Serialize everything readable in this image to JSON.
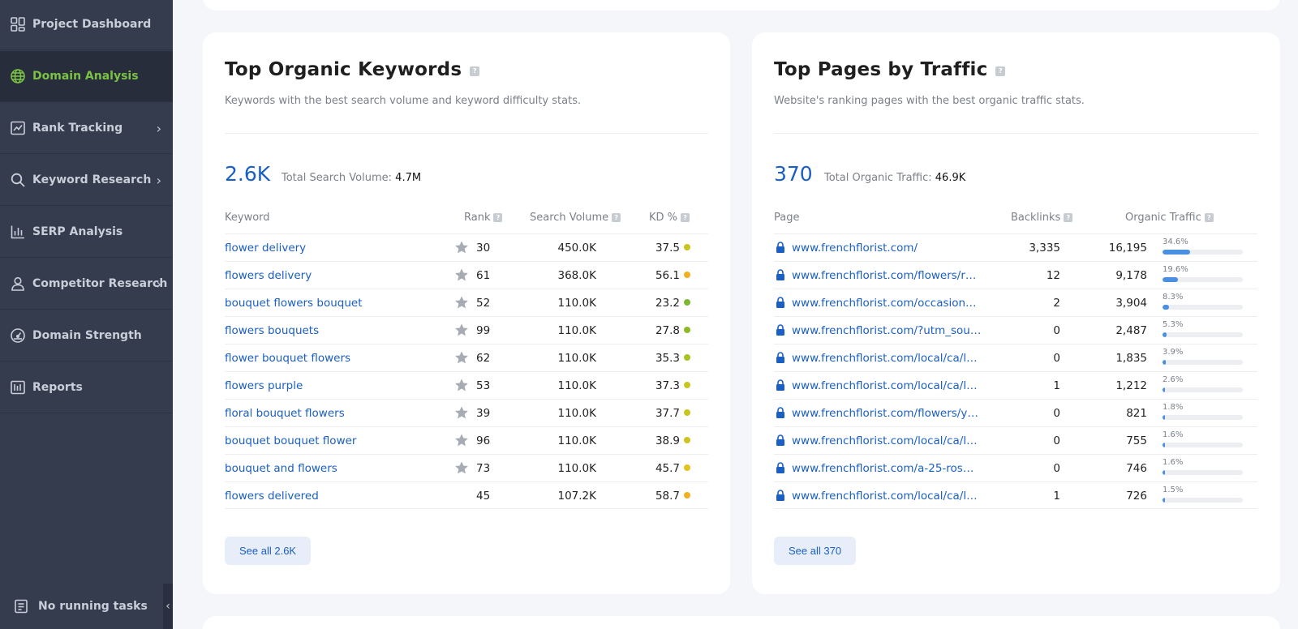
{
  "sidebar": {
    "items": [
      {
        "label": "Project Dashboard",
        "icon": "grid-icon",
        "top": 0,
        "active": false,
        "chevron": false
      },
      {
        "label": "Domain Analysis",
        "icon": "globe-icon",
        "active": true,
        "chevron": false
      },
      {
        "label": "Rank Tracking",
        "icon": "chart-line-icon",
        "active": false,
        "chevron": true
      },
      {
        "label": "Keyword Research",
        "icon": "search-icon",
        "active": false,
        "chevron": true
      },
      {
        "label": "SERP Analysis",
        "icon": "bar-chart-icon",
        "active": false,
        "chevron": false
      },
      {
        "label": "Competitor Research",
        "icon": "user-icon",
        "active": false,
        "chevron": true
      },
      {
        "label": "Domain Strength",
        "icon": "gauge-icon",
        "active": false,
        "chevron": false
      },
      {
        "label": "Reports",
        "icon": "reports-icon",
        "active": false,
        "chevron": false
      }
    ],
    "tasks_label": "No running tasks",
    "collapse_glyph": "‹",
    "chevron_glyph": "›"
  },
  "keywords": {
    "title": "Top Organic Keywords",
    "description": "Keywords with the best search volume and keyword difficulty stats.",
    "count": "2.6K",
    "total_label": "Total Search Volume:",
    "total_value": "4.7M",
    "columns": {
      "keyword": "Keyword",
      "rank": "Rank",
      "volume": "Search Volume",
      "kd": "KD %"
    },
    "rows": [
      {
        "keyword": "flower delivery",
        "starred": true,
        "rank": "30",
        "volume": "450.0K",
        "kd": "37.5",
        "kd_color": "#c8c61c"
      },
      {
        "keyword": "flowers delivery",
        "starred": true,
        "rank": "61",
        "volume": "368.0K",
        "kd": "56.1",
        "kd_color": "#f2b01e"
      },
      {
        "keyword": "bouquet flowers bouquet",
        "starred": true,
        "rank": "52",
        "volume": "110.0K",
        "kd": "23.2",
        "kd_color": "#7cb82f"
      },
      {
        "keyword": "flowers bouquets",
        "starred": true,
        "rank": "99",
        "volume": "110.0K",
        "kd": "27.8",
        "kd_color": "#8cba25"
      },
      {
        "keyword": "flower bouquet flowers",
        "starred": true,
        "rank": "62",
        "volume": "110.0K",
        "kd": "35.3",
        "kd_color": "#a9c21f"
      },
      {
        "keyword": "flowers purple",
        "starred": true,
        "rank": "53",
        "volume": "110.0K",
        "kd": "37.3",
        "kd_color": "#c8c61c"
      },
      {
        "keyword": "floral bouquet flowers",
        "starred": true,
        "rank": "39",
        "volume": "110.0K",
        "kd": "37.7",
        "kd_color": "#c8c61c"
      },
      {
        "keyword": "bouquet bouquet flower",
        "starred": true,
        "rank": "96",
        "volume": "110.0K",
        "kd": "38.9",
        "kd_color": "#cfc41b"
      },
      {
        "keyword": "bouquet and flowers",
        "starred": true,
        "rank": "73",
        "volume": "110.0K",
        "kd": "45.7",
        "kd_color": "#e5c21a"
      },
      {
        "keyword": "flowers delivered",
        "starred": false,
        "rank": "45",
        "volume": "107.2K",
        "kd": "58.7",
        "kd_color": "#f2b01e"
      }
    ],
    "button": "See all 2.6K"
  },
  "pages": {
    "title": "Top Pages by Traffic",
    "description": "Website's ranking pages with the best organic traffic stats.",
    "count": "370",
    "total_label": "Total Organic Traffic:",
    "total_value": "46.9K",
    "columns": {
      "page": "Page",
      "backlinks": "Backlinks",
      "traffic": "Organic Traffic"
    },
    "rows": [
      {
        "page": "www.frenchflorist.com/",
        "backlinks": "3,335",
        "traffic": "16,195",
        "pct": "34.6%",
        "share": 34.6
      },
      {
        "page": "www.frenchflorist.com/flowers/r…",
        "backlinks": "12",
        "traffic": "9,178",
        "pct": "19.6%",
        "share": 19.6
      },
      {
        "page": "www.frenchflorist.com/occasion…",
        "backlinks": "2",
        "traffic": "3,904",
        "pct": "8.3%",
        "share": 8.3
      },
      {
        "page": "www.frenchflorist.com/?utm_sou…",
        "backlinks": "0",
        "traffic": "2,487",
        "pct": "5.3%",
        "share": 5.3
      },
      {
        "page": "www.frenchflorist.com/local/ca/l…",
        "backlinks": "0",
        "traffic": "1,835",
        "pct": "3.9%",
        "share": 3.9
      },
      {
        "page": "www.frenchflorist.com/local/ca/l…",
        "backlinks": "1",
        "traffic": "1,212",
        "pct": "2.6%",
        "share": 2.6
      },
      {
        "page": "www.frenchflorist.com/flowers/y…",
        "backlinks": "0",
        "traffic": "821",
        "pct": "1.8%",
        "share": 1.8
      },
      {
        "page": "www.frenchflorist.com/local/ca/l…",
        "backlinks": "0",
        "traffic": "755",
        "pct": "1.6%",
        "share": 1.6
      },
      {
        "page": "www.frenchflorist.com/a-25-ros…",
        "backlinks": "0",
        "traffic": "746",
        "pct": "1.6%",
        "share": 1.6
      },
      {
        "page": "www.frenchflorist.com/local/ca/l…",
        "backlinks": "1",
        "traffic": "726",
        "pct": "1.5%",
        "share": 1.5
      }
    ],
    "button": "See all 370"
  },
  "colors": {
    "accent": "#1a5fc4",
    "active_nav": "#7bc144",
    "sidebar": "#343c4e",
    "bar": "#4a90e2"
  }
}
